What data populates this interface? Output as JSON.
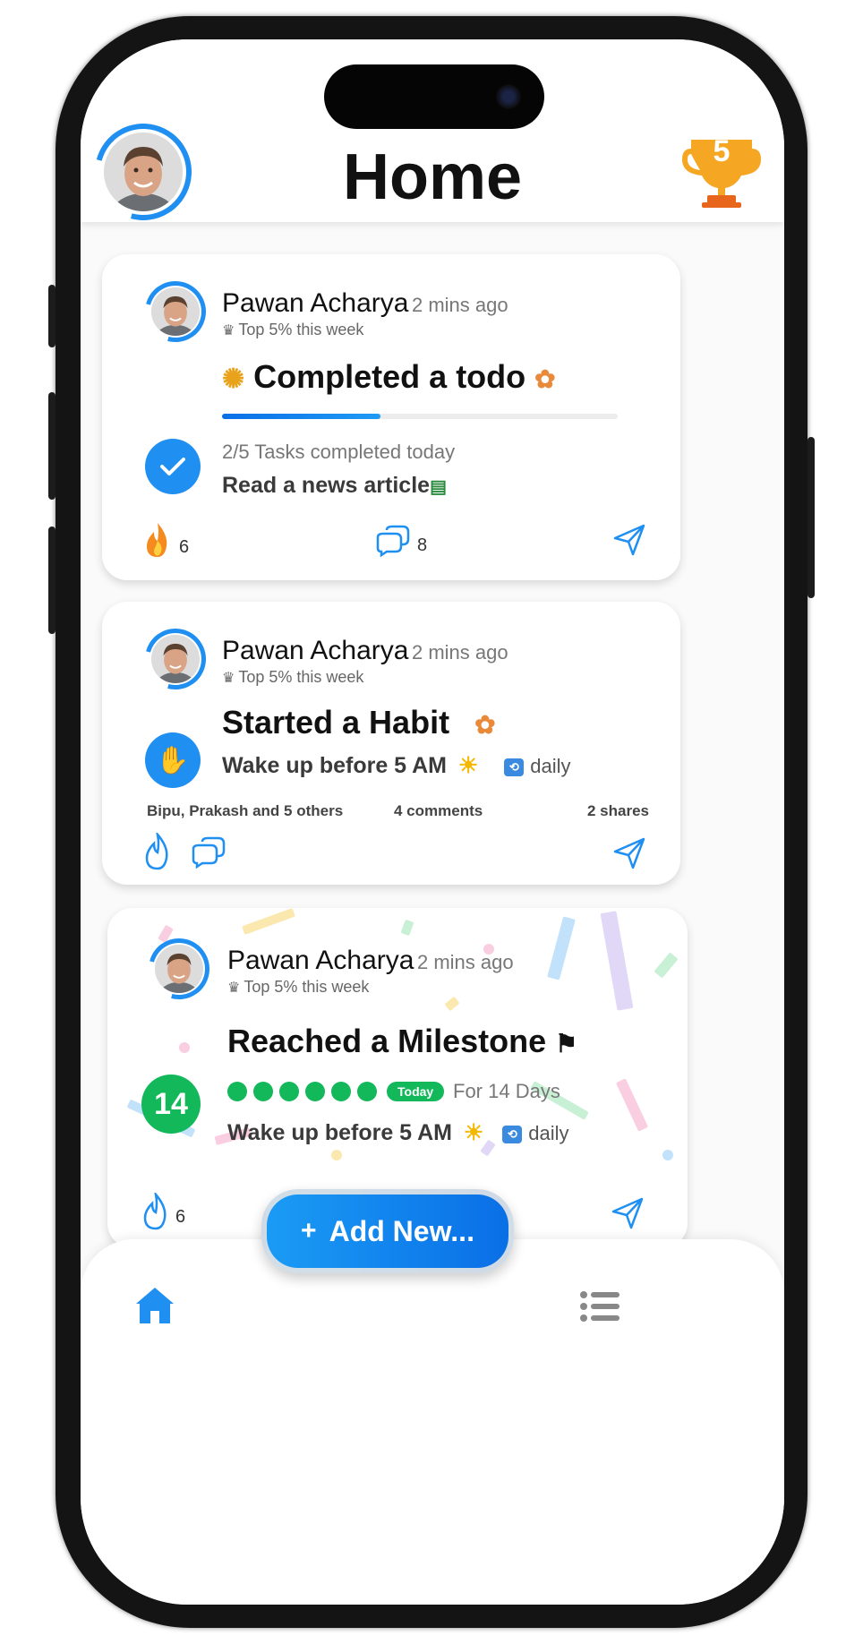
{
  "header": {
    "title": "Home",
    "trophy_rank": "5"
  },
  "feed": [
    {
      "author": "Pawan Acharya",
      "time": "2 mins ago",
      "rank": "Top 5% this week",
      "headline": "Completed a todo",
      "progress": 0.4,
      "tasks_summary": "2/5 Tasks completed today",
      "task": "Read a news article",
      "fire_count": "6",
      "comment_count": "8"
    },
    {
      "author": "Pawan Acharya",
      "time": "2 mins ago",
      "rank": "Top 5% this week",
      "headline": "Started a Habit",
      "task": "Wake up before 5 AM",
      "repeat": "daily",
      "likes_text": "Bipu, Prakash and 5 others",
      "comments_text": "4 comments",
      "shares_text": "2 shares"
    },
    {
      "author": "Pawan Acharya",
      "time": "2 mins ago",
      "rank": "Top 5% this week",
      "headline": "Reached a Milestone",
      "streak_number": "14",
      "today_badge": "Today",
      "duration": "For 14 Days",
      "task": "Wake up before 5 AM",
      "repeat": "daily",
      "fire_count": "6"
    }
  ],
  "add_button": {
    "plus": "+",
    "label": "Add New..."
  },
  "nav": {
    "home": "home-icon",
    "list": "list-icon"
  },
  "colors": {
    "accent": "#1f8ff2",
    "success": "#12b85a",
    "fire": "#f58a1f"
  }
}
